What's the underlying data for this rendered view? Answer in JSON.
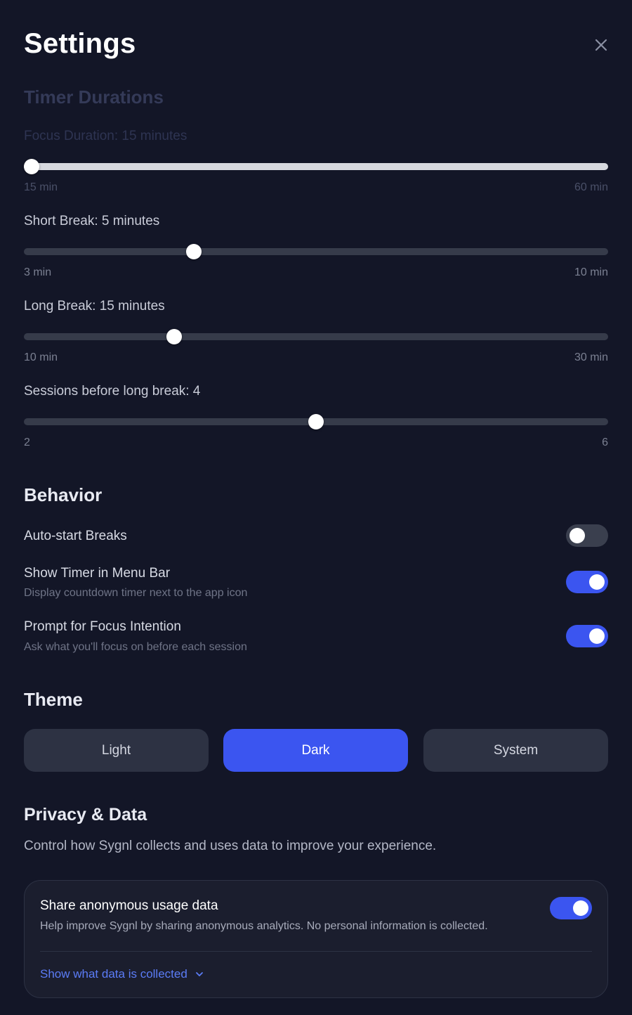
{
  "header": {
    "title": "Settings",
    "close_icon": "close-icon"
  },
  "timer": {
    "title": "Timer Durations",
    "sliders": [
      {
        "label": "Focus Duration: 15 minutes",
        "min_label": "15 min",
        "max_label": "60 min",
        "value": 15,
        "min": 15,
        "max": 60
      },
      {
        "label": "Short Break: 5 minutes",
        "min_label": "3 min",
        "max_label": "10 min",
        "value": 5,
        "min": 3,
        "max": 10
      },
      {
        "label": "Long Break: 15 minutes",
        "min_label": "10 min",
        "max_label": "30 min",
        "value": 15,
        "min": 10,
        "max": 30
      },
      {
        "label": "Sessions before long break: 4",
        "min_label": "2",
        "max_label": "6",
        "value": 4,
        "min": 2,
        "max": 6
      }
    ]
  },
  "behavior": {
    "title": "Behavior",
    "toggles": [
      {
        "label": "Auto-start Breaks",
        "description": "",
        "on": false
      },
      {
        "label": "Show Timer in Menu Bar",
        "description": "Display countdown timer next to the app icon",
        "on": true
      },
      {
        "label": "Prompt for Focus Intention",
        "description": "Ask what you'll focus on before each session",
        "on": true
      }
    ]
  },
  "theme": {
    "title": "Theme",
    "options": [
      "Light",
      "Dark",
      "System"
    ],
    "selected": "Dark"
  },
  "privacy": {
    "title": "Privacy & Data",
    "description": "Control how Sygnl collects and uses data to improve your experience.",
    "card": {
      "title": "Share anonymous usage data",
      "description": "Help improve Sygnl by sharing anonymous analytics. No personal information is collected.",
      "on": true,
      "link": "Show what data is collected",
      "link_icon": "chevron-down-icon"
    }
  },
  "colors": {
    "background": "#131627",
    "accent": "#3b55f0",
    "link": "#5b7cf6"
  }
}
